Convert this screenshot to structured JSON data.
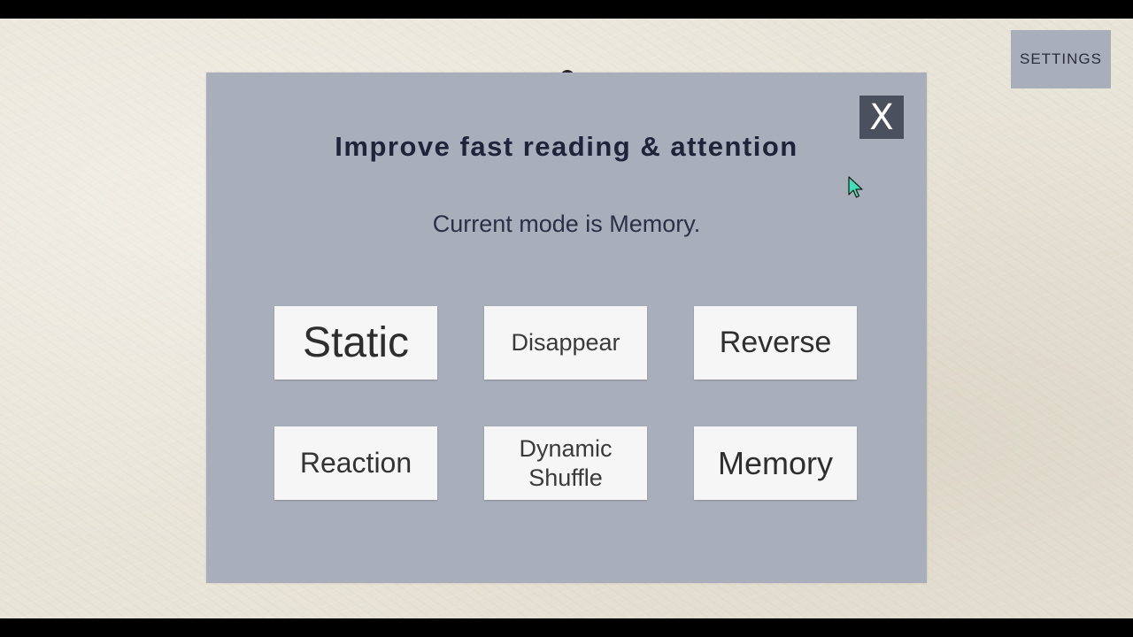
{
  "header": {
    "settings_label": "SETTINGS"
  },
  "modal": {
    "close_label": "X",
    "title": "Improve fast reading & attention",
    "status_text": "Current mode is Memory.",
    "modes": [
      {
        "label": "Static"
      },
      {
        "label": "Disappear"
      },
      {
        "label": "Reverse"
      },
      {
        "label": "Reaction"
      },
      {
        "label": "Dynamic\nShuffle"
      },
      {
        "label": "Memory"
      }
    ]
  },
  "colors": {
    "panel": "#a9aebb",
    "close_button": "#4a505e",
    "button_bg": "#f6f6f6",
    "title_text": "#20243a",
    "cursor": "#3fe0b8"
  },
  "icons": {
    "cursor": "mouse-pointer-icon"
  }
}
